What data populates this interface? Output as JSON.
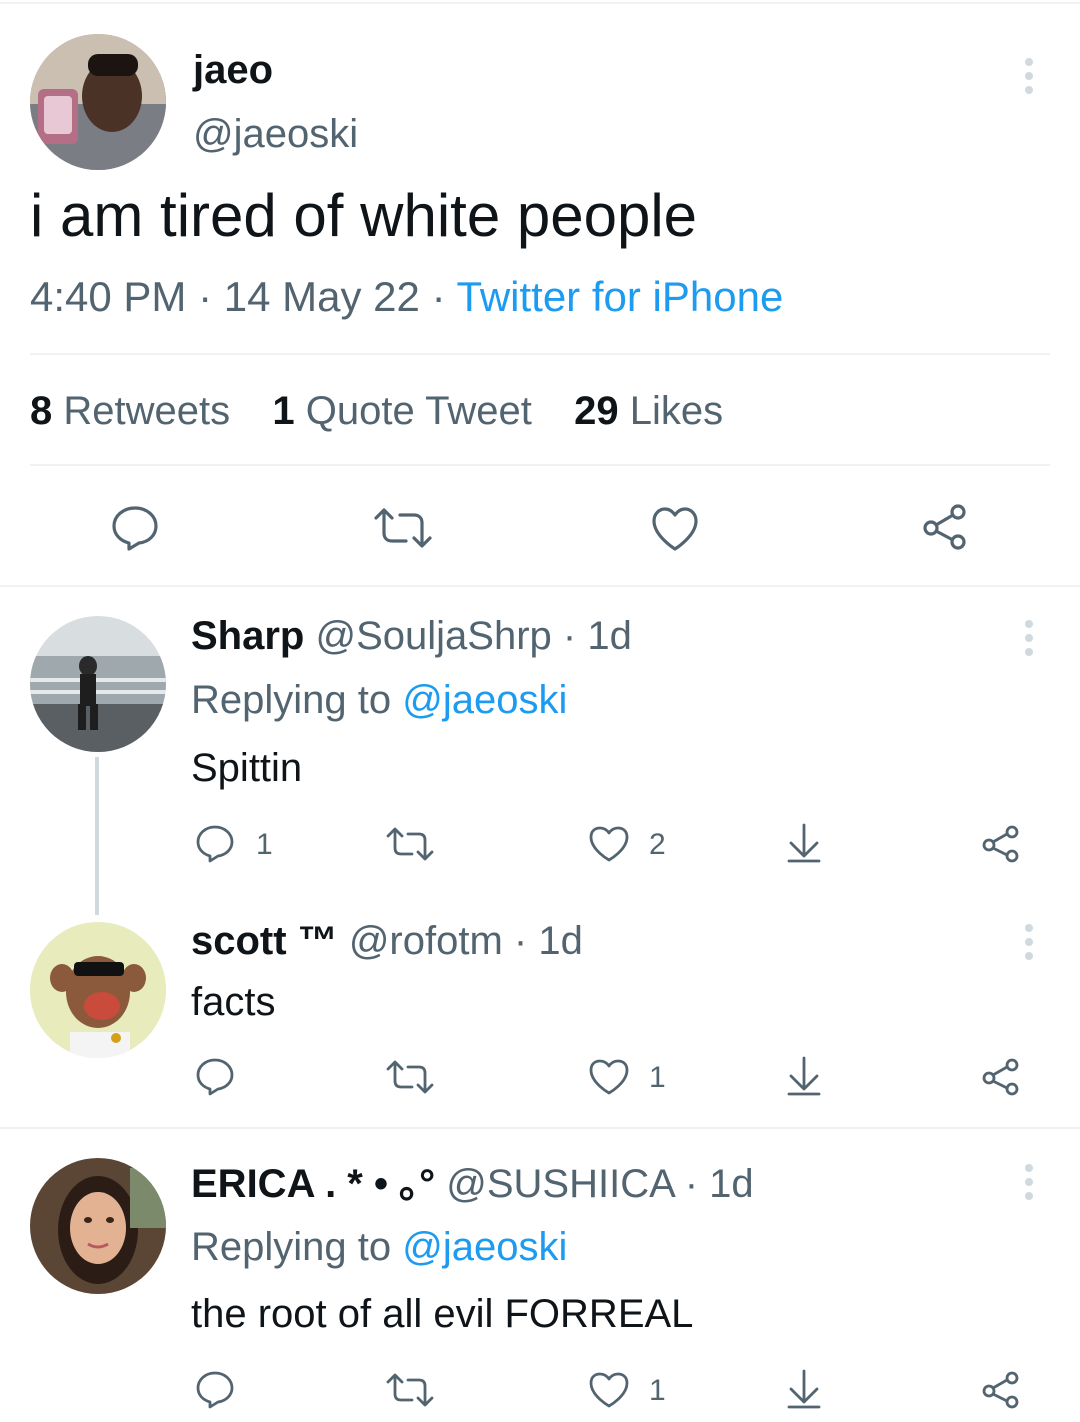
{
  "main_tweet": {
    "display_name": "jaeo",
    "handle": "@jaeoski",
    "text": "i am tired of white people",
    "time": "4:40 PM",
    "sep1": "·",
    "date": "14 May 22",
    "sep2": "·",
    "source": "Twitter for iPhone",
    "stats": {
      "retweets_count": "8",
      "retweets_label": "Retweets",
      "quotes_count": "1",
      "quotes_label": "Quote Tweet",
      "likes_count": "29",
      "likes_label": "Likes"
    }
  },
  "replies": [
    {
      "display_name": "Sharp",
      "handle": "@SouljaShrp",
      "sep": "·",
      "age": "1d",
      "replying_prefix": "Replying to",
      "replying_handle": "@jaeoski",
      "text": "Spittin",
      "reply_count": "1",
      "like_count": "2"
    },
    {
      "display_name": "scott ™",
      "handle": "@rofotm",
      "sep": "·",
      "age": "1d",
      "text": "facts",
      "like_count": "1"
    },
    {
      "display_name": "ERICA . * • ｡°",
      "handle": "@SUSHIICA",
      "sep": "·",
      "age": "1d",
      "replying_prefix": "Replying to",
      "replying_handle": "@jaeoski",
      "text": "the root of all evil FORREAL",
      "like_count": "1"
    }
  ],
  "icons": {
    "reply": "speech-bubble-icon",
    "retweet": "retweet-arrows-icon",
    "like": "heart-outline-icon",
    "share": "share-nodes-icon",
    "download": "download-arrow-icon",
    "more": "vertical-dots-icon"
  },
  "colors": {
    "accent": "#1d9bf0",
    "muted": "#536471",
    "divider": "#eff3f4",
    "text": "#0f1419"
  }
}
